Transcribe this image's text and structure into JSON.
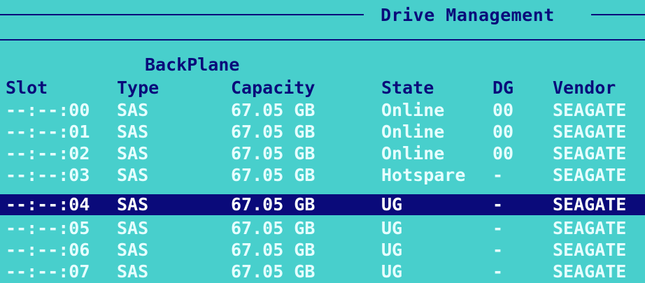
{
  "window": {
    "title": "Drive Management"
  },
  "group_label": "BackPlane",
  "columns": {
    "slot": "Slot",
    "type": "Type",
    "capacity": "Capacity",
    "state": "State",
    "dg": "DG",
    "vendor": "Vendor"
  },
  "drives": [
    {
      "slot": "--:--:00",
      "type": "SAS",
      "capacity": "67.05 GB",
      "state": "Online",
      "dg": "00",
      "vendor": "SEAGATE"
    },
    {
      "slot": "--:--:01",
      "type": "SAS",
      "capacity": "67.05 GB",
      "state": "Online",
      "dg": "00",
      "vendor": "SEAGATE"
    },
    {
      "slot": "--:--:02",
      "type": "SAS",
      "capacity": "67.05 GB",
      "state": "Online",
      "dg": "00",
      "vendor": "SEAGATE"
    },
    {
      "slot": "--:--:03",
      "type": "SAS",
      "capacity": "67.05 GB",
      "state": "Hotspare",
      "dg": "-",
      "vendor": "SEAGATE"
    },
    {
      "slot": "--:--:04",
      "type": "SAS",
      "capacity": "67.05 GB",
      "state": "UG",
      "dg": "-",
      "vendor": "SEAGATE"
    },
    {
      "slot": "--:--:05",
      "type": "SAS",
      "capacity": "67.05 GB",
      "state": "UG",
      "dg": "-",
      "vendor": "SEAGATE"
    },
    {
      "slot": "--:--:06",
      "type": "SAS",
      "capacity": "67.05 GB",
      "state": "UG",
      "dg": "-",
      "vendor": "SEAGATE"
    },
    {
      "slot": "--:--:07",
      "type": "SAS",
      "capacity": "67.05 GB",
      "state": "UG",
      "dg": "-",
      "vendor": "SEAGATE"
    }
  ],
  "selected_index": 4,
  "colors": {
    "background": "#48cfcc",
    "frame": "#0a0a7a",
    "highlight": "#0a0a7a",
    "row_text": "#e6ffff"
  }
}
